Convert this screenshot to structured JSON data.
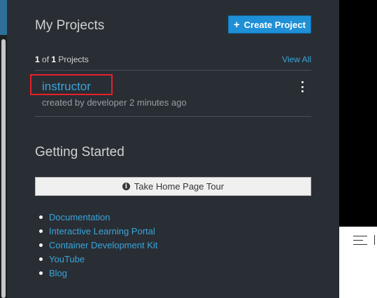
{
  "my_projects": {
    "title": "My Projects",
    "create_label": "Create Project",
    "count_current": "1",
    "count_of": "of",
    "count_total": "1",
    "count_suffix": "Projects",
    "view_all": "View All"
  },
  "project": {
    "name": "instructor",
    "meta": "created by developer 2 minutes ago"
  },
  "getting_started": {
    "title": "Getting Started",
    "tour_label": "Take Home Page Tour",
    "links": [
      "Documentation",
      "Interactive Learning Portal",
      "Container Development Kit",
      "YouTube",
      "Blog"
    ]
  },
  "colors": {
    "panel_bg": "#292e34",
    "link": "#39a5dc",
    "primary_button": "#1f8fd6",
    "highlight_box": "#e8202a"
  },
  "icons": {
    "create": "plus-icon",
    "kebab": "kebab-icon",
    "tour": "info-circle-icon",
    "menu": "menu-lines-icon"
  }
}
